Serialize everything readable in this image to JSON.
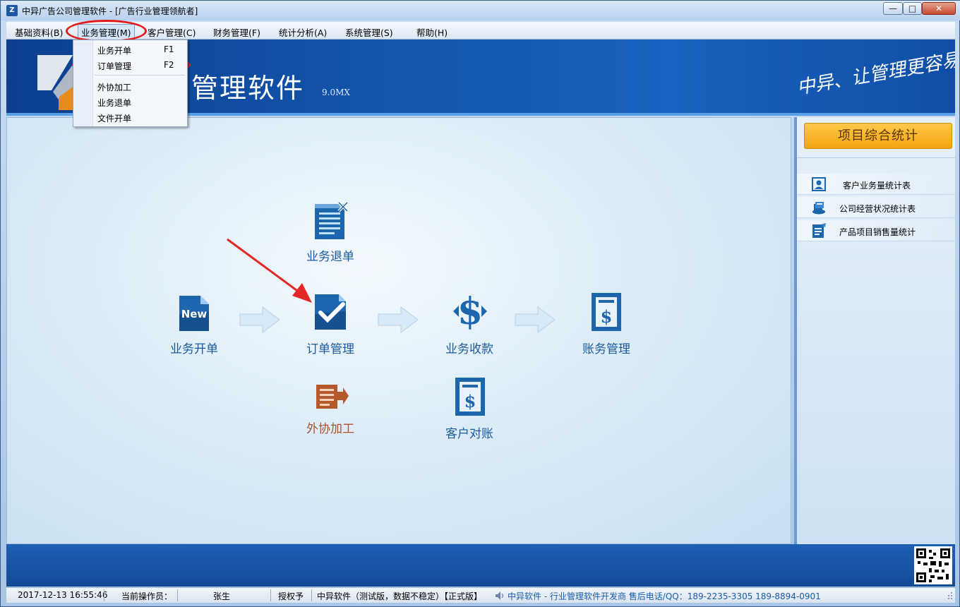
{
  "window": {
    "title": "中异广告公司管理软件 - [广告行业管理领航者]",
    "app_icon_text": "Z",
    "minimize_glyph": "—",
    "maximize_glyph": "□",
    "close_glyph": "✕"
  },
  "menubar": {
    "items": [
      {
        "label": "基础资料(B)"
      },
      {
        "label": "业务管理(M)"
      },
      {
        "label": "客户管理(C)"
      },
      {
        "label": "财务管理(F)"
      },
      {
        "label": "统计分析(A)"
      },
      {
        "label": "系统管理(S)"
      },
      {
        "label": "帮助(H)"
      }
    ]
  },
  "dropdown": {
    "items": [
      {
        "label": "业务开单",
        "shortcut": "F1"
      },
      {
        "label": "订单管理",
        "shortcut": "F2"
      },
      {
        "label": "外协加工",
        "shortcut": ""
      },
      {
        "label": "业务退单",
        "shortcut": ""
      },
      {
        "label": "文件开单",
        "shortcut": ""
      }
    ]
  },
  "banner": {
    "title": "司管理软件",
    "version": "9.0MX",
    "slogan": "中异、让管理更容易"
  },
  "flow": {
    "nodes": [
      {
        "label": "业务退单",
        "icon": "document-cancel-icon"
      },
      {
        "label": "业务开单",
        "icon": "new-document-icon",
        "icon_text": "New"
      },
      {
        "label": "订单管理",
        "icon": "checked-document-icon"
      },
      {
        "label": "业务收款",
        "icon": "dollar-arrows-icon",
        "icon_text": "$"
      },
      {
        "label": "账务管理",
        "icon": "ledger-dollar-icon",
        "icon_text": "$"
      },
      {
        "label": "外协加工",
        "icon": "outsource-document-icon"
      },
      {
        "label": "客户对账",
        "icon": "statement-dollar-icon",
        "icon_text": "$"
      }
    ]
  },
  "side_panel": {
    "stat_button": "项目综合统计",
    "reports": [
      {
        "label": "客户业务量统计表",
        "icon": "user-card-icon"
      },
      {
        "label": "公司经营状况统计表",
        "icon": "company-stats-icon"
      },
      {
        "label": "产品项目销售量统计",
        "icon": "product-sales-icon"
      }
    ]
  },
  "statusbar": {
    "datetime": "2017-12-13 16:55:46",
    "operator_label": "当前操作员：",
    "operator_name": "张生",
    "license_label": "授权予",
    "edition": "中异软件（测试版，数据不稳定）【正式版】",
    "info": "中异软件 - 行业管理软件开发商   售后电话/QQ：189-2235-3305  189-8894-0901"
  },
  "colors": {
    "accent_blue": "#1b5a9c",
    "highlight_red": "#e11c1c",
    "stat_button_orange": "#f4a40f",
    "banner_blue": "#1458b1"
  }
}
